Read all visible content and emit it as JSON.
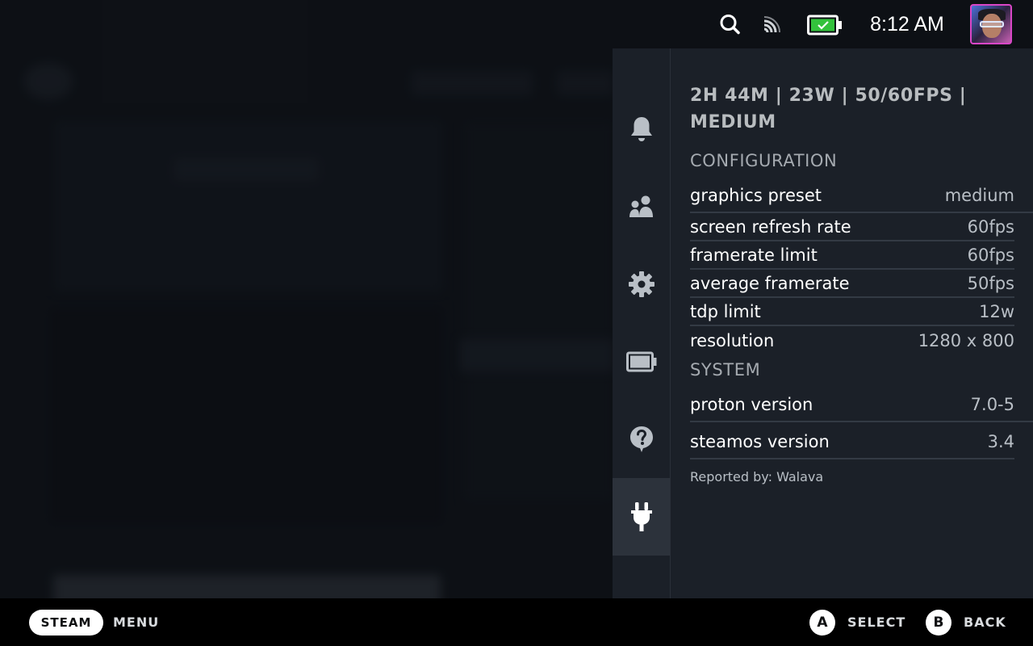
{
  "topbar": {
    "icons": [
      "search-icon",
      "cast-icon",
      "battery-icon"
    ],
    "battery_color": "#33c23c",
    "time": "8:12 AM"
  },
  "nav": {
    "items": [
      "bell-icon",
      "friends-icon",
      "gear-icon",
      "battery-icon",
      "help-icon",
      "plug-icon"
    ],
    "active": "plug-icon"
  },
  "report": {
    "summary": "2H 44M | 23W | 50/60FPS | MEDIUM",
    "configuration_heading": "CONFIGURATION",
    "configuration": [
      {
        "label": "graphics preset",
        "value": "medium"
      },
      {
        "label": "screen refresh rate",
        "value": "60fps"
      },
      {
        "label": "framerate limit",
        "value": "60fps"
      },
      {
        "label": "average framerate",
        "value": "50fps"
      },
      {
        "label": "tdp limit",
        "value": "12w"
      },
      {
        "label": "resolution",
        "value": "1280 x 800"
      }
    ],
    "system_heading": "SYSTEM",
    "system": [
      {
        "label": "proton version",
        "value": "7.0-5"
      },
      {
        "label": "steamos version",
        "value": "3.4"
      }
    ],
    "reported_by": "Reported by: Walava"
  },
  "bottombar": {
    "steam_label": "STEAM",
    "menu_label": "MENU",
    "a_label": "A",
    "select_label": "SELECT",
    "b_label": "B",
    "back_label": "BACK"
  },
  "colors": {
    "panel_bg": "#1b2028",
    "accent_avatar_border": "#d946c7",
    "text_primary": "#ffffff",
    "text_secondary": "#b9bfc6"
  }
}
